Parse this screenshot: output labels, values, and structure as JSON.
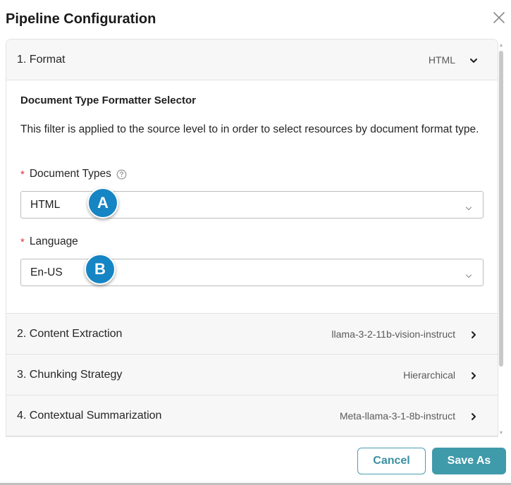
{
  "dialog": {
    "title": "Pipeline Configuration",
    "close_icon": "close-icon"
  },
  "panels": [
    {
      "label": "1. Format",
      "value": "HTML",
      "expanded": true,
      "chevron_icon": "chevron-down-icon"
    },
    {
      "label": "2. Content Extraction",
      "value": "llama-3-2-11b-vision-instruct",
      "expanded": false,
      "chevron_icon": "chevron-right-icon"
    },
    {
      "label": "3. Chunking Strategy",
      "value": "Hierarchical",
      "expanded": false,
      "chevron_icon": "chevron-right-icon"
    },
    {
      "label": "4. Contextual Summarization",
      "value": "Meta-llama-3-1-8b-instruct",
      "expanded": false,
      "chevron_icon": "chevron-right-icon"
    }
  ],
  "format_panel": {
    "section_title": "Document Type Formatter Selector",
    "description": "This filter is applied to the source level to in order to select resources by document format type.",
    "document_types": {
      "required_mark": "*",
      "label": "Document Types",
      "help_icon": "question-circle-icon",
      "value": "HTML"
    },
    "language": {
      "required_mark": "*",
      "label": "Language",
      "value": "En-US"
    }
  },
  "annotations": {
    "a": "A",
    "b": "B"
  },
  "footer": {
    "cancel_label": "Cancel",
    "save_as_label": "Save As"
  },
  "colors": {
    "accent": "#3f9aaa",
    "badge": "#1585c4",
    "required": "#d9363e"
  }
}
